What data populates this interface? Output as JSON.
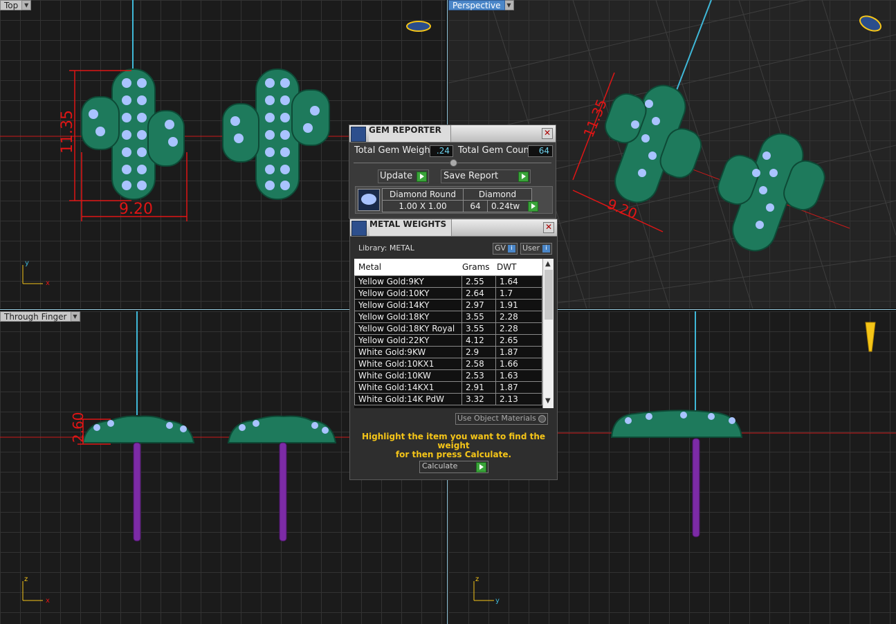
{
  "viewports": {
    "top": {
      "label": "Top",
      "dim_height": "11.35",
      "dim_width": "9.20",
      "axis_x": "x",
      "axis_y": "y"
    },
    "perspective": {
      "label": "Perspective",
      "dim_height": "11.35",
      "dim_width": "9.20"
    },
    "through_finger": {
      "label": "Through Finger",
      "dim_height": "2.60",
      "axis_z": "z",
      "axis_x": "x"
    },
    "side": {
      "axis_z": "z",
      "axis_y": "y"
    }
  },
  "gem_reporter": {
    "title": "GEM REPORTER",
    "total_weight_label": "Total Gem Weight",
    "total_weight_value": ".24",
    "total_count_label": "Total Gem Count",
    "total_count_value": "64",
    "update_label": "Update",
    "save_report_label": "Save Report",
    "gem_row": {
      "shape": "Diamond Round",
      "size": "1.00 X 1.00",
      "material": "Diamond",
      "count": "64",
      "weight": "0.24tw"
    }
  },
  "metal_weights": {
    "title": "METAL WEIGHTS",
    "library_label": "Library: METAL",
    "gv_label": "GV",
    "user_label": "User",
    "columns": [
      "Metal",
      "Grams",
      "DWT"
    ],
    "rows": [
      [
        "Yellow Gold:9KY",
        "2.55",
        "1.64"
      ],
      [
        "Yellow Gold:10KY",
        "2.64",
        "1.7"
      ],
      [
        "Yellow Gold:14KY",
        "2.97",
        "1.91"
      ],
      [
        "Yellow Gold:18KY",
        "3.55",
        "2.28"
      ],
      [
        "Yellow Gold:18KY Royal",
        "3.55",
        "2.28"
      ],
      [
        "Yellow Gold:22KY",
        "4.12",
        "2.65"
      ],
      [
        "White Gold:9KW",
        "2.9",
        "1.87"
      ],
      [
        "White Gold:10KX1",
        "2.58",
        "1.66"
      ],
      [
        "White Gold:10KW",
        "2.53",
        "1.63"
      ],
      [
        "White Gold:14KX1",
        "2.91",
        "1.87"
      ],
      [
        "White Gold:14K PdW",
        "3.32",
        "2.13"
      ]
    ],
    "use_object_materials": "Use Object Materials",
    "instruction_line1": "Highlight the item you want to find the weight",
    "instruction_line2": "for then press Calculate.",
    "calculate_label": "Calculate"
  },
  "colors": {
    "accent": "#f5c518",
    "body": "#1e7a5c",
    "gem": "#a9c3ff",
    "dimension": "#e01515",
    "stem": "#7c2ba6",
    "axis": "#3fb8d8"
  }
}
